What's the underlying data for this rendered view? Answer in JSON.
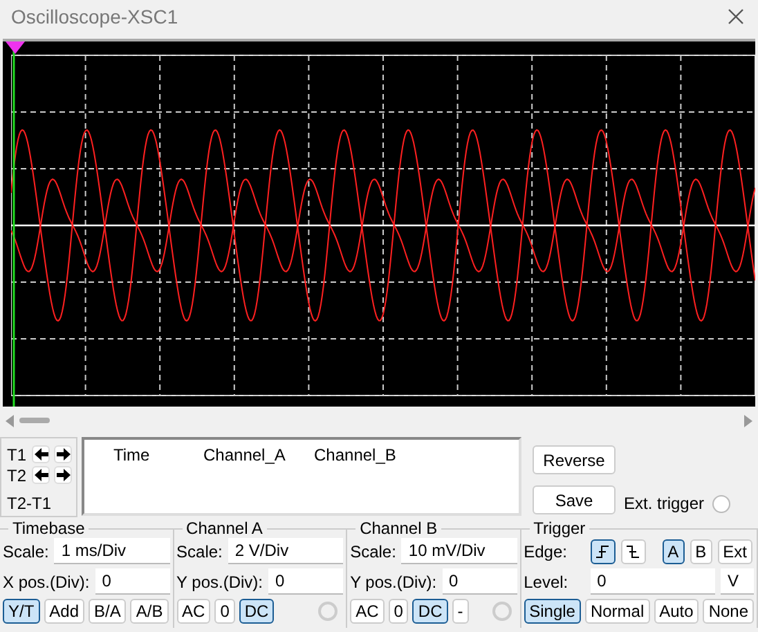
{
  "window": {
    "title": "Oscilloscope-XSC1"
  },
  "cursors": [
    {
      "label": "T1",
      "kind": "stepper"
    },
    {
      "label": "T2",
      "kind": "stepper"
    },
    {
      "label": "T2-T1",
      "kind": "delta"
    }
  ],
  "readout": {
    "columns": [
      "Time",
      "Channel_A",
      "Channel_B"
    ]
  },
  "actions": [
    "Reverse",
    "Save"
  ],
  "ext_trigger": {
    "label": "Ext. trigger",
    "checked": false
  },
  "timebase": {
    "title": "Timebase",
    "fields": [
      {
        "label": "Scale:",
        "value": "1 ms/Div"
      },
      {
        "label": "X pos.(Div):",
        "value": "0"
      }
    ],
    "modes": [
      {
        "label": "Y/T",
        "selected": true
      },
      {
        "label": "Add",
        "selected": false
      },
      {
        "label": "B/A",
        "selected": false
      },
      {
        "label": "A/B",
        "selected": false
      }
    ]
  },
  "channels": [
    {
      "title": "Channel A",
      "fields": [
        {
          "label": "Scale:",
          "value": "2  V/Div"
        },
        {
          "label": "Y pos.(Div):",
          "value": "0"
        }
      ],
      "coupling": [
        {
          "label": "AC",
          "selected": false
        },
        {
          "label": "0",
          "selected": false
        },
        {
          "label": "DC",
          "selected": true
        }
      ]
    },
    {
      "title": "Channel B",
      "fields": [
        {
          "label": "Scale:",
          "value": "10 mV/Div"
        },
        {
          "label": "Y pos.(Div):",
          "value": "0"
        }
      ],
      "coupling": [
        {
          "label": "AC",
          "selected": false
        },
        {
          "label": "0",
          "selected": false
        },
        {
          "label": "DC",
          "selected": true
        },
        {
          "label": "-",
          "selected": false
        }
      ]
    }
  ],
  "trigger": {
    "title": "Trigger",
    "edge_label": "Edge:",
    "edges": [
      {
        "kind": "rising",
        "selected": true
      },
      {
        "kind": "falling",
        "selected": false
      }
    ],
    "sources": [
      {
        "label": "A",
        "selected": true
      },
      {
        "label": "B",
        "selected": false
      },
      {
        "label": "Ext",
        "selected": false
      }
    ],
    "level": {
      "label": "Level:",
      "value": "0",
      "unit": "V"
    },
    "modes": [
      {
        "label": "Single",
        "selected": true
      },
      {
        "label": "Normal",
        "selected": false
      },
      {
        "label": "Auto",
        "selected": false
      },
      {
        "label": "None",
        "selected": false
      }
    ]
  }
}
